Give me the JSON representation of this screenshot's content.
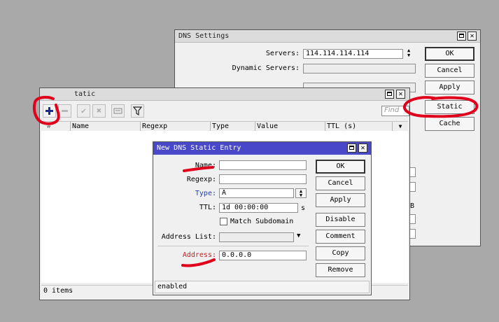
{
  "dns_settings": {
    "title": "DNS Settings",
    "servers_label": "Servers:",
    "servers_value": "114.114.114.114",
    "dynamic_servers_label": "Dynamic Servers:",
    "dynamic_servers_value": "",
    "b_unit": "B",
    "buttons": {
      "ok": "OK",
      "cancel": "Cancel",
      "apply": "Apply",
      "static": "Static",
      "cache": "Cache"
    }
  },
  "dns_static": {
    "title_fragment": "tatic",
    "search_placeholder": "Find",
    "columns": [
      "#",
      "Name",
      "Regexp",
      "Type",
      "Value",
      "TTL (s)"
    ],
    "status": "0 items",
    "toolbar_icons": [
      "add-icon",
      "remove-icon",
      "enable-icon",
      "disable-icon",
      "comment-icon",
      "filter-icon"
    ]
  },
  "entry": {
    "title": "New DNS Static Entry",
    "labels": {
      "name": "Name:",
      "regexp": "Regexp:",
      "type": "Type:",
      "ttl": "TTL:",
      "match_subdomain": "Match Subdomain",
      "address_list": "Address List:",
      "address": "Address:"
    },
    "values": {
      "name": "",
      "regexp": "",
      "type": "A",
      "ttl": "1d 00:00:00",
      "ttl_unit": "s",
      "address_list": "",
      "address": "0.0.0.0",
      "match_subdomain": false
    },
    "buttons": {
      "ok": "OK",
      "cancel": "Cancel",
      "apply": "Apply",
      "disable": "Disable",
      "comment": "Comment",
      "copy": "Copy",
      "remove": "Remove"
    },
    "status": "enabled"
  },
  "colors": {
    "annotation": "#e0001b",
    "title_active": "#4848c8",
    "link_label": "#1f3fb0",
    "required_label": "#c02020"
  }
}
